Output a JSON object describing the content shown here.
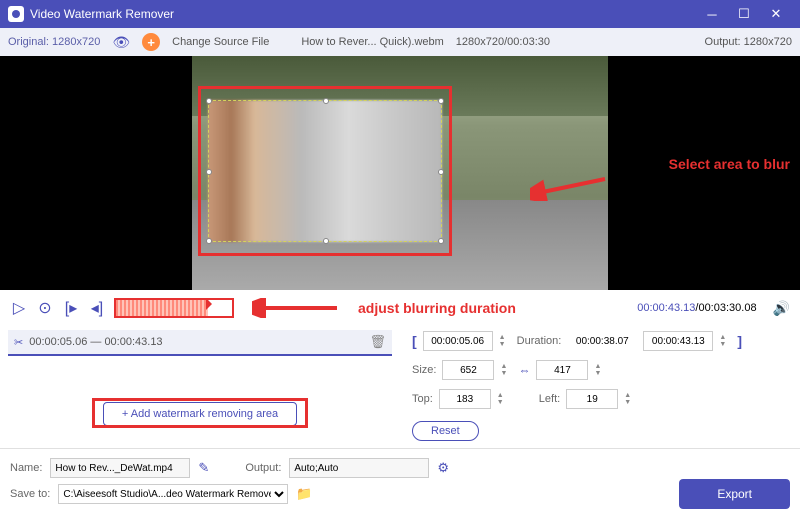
{
  "titlebar": {
    "title": "Video Watermark Remover"
  },
  "infobar": {
    "original": "Original: 1280x720",
    "change_src": "Change Source File",
    "filename": "How to Rever... Quick).webm",
    "dims": "1280x720/00:03:30",
    "output": "Output: 1280x720"
  },
  "annotations": {
    "select_area": "Select area to blur",
    "adjust_dur": "adjust blurring duration"
  },
  "controls": {
    "time_cur": "00:00:43.13",
    "time_total": "/00:03:30.08"
  },
  "region": {
    "range": "00:00:05.06 — 00:00:43.13"
  },
  "params": {
    "start": "00:00:05.06",
    "dur_label": "Duration:",
    "dur": "00:00:38.07",
    "end": "00:00:43.13",
    "size_label": "Size:",
    "size_w": "652",
    "size_h": "417",
    "top_label": "Top:",
    "top": "183",
    "left_label": "Left:",
    "left": "19",
    "reset": "Reset"
  },
  "add_btn": "Add watermark removing area",
  "bottom": {
    "name_label": "Name:",
    "name": "How to Rev..._DeWat.mp4",
    "output_label": "Output:",
    "output": "Auto;Auto",
    "saveto_label": "Save to:",
    "saveto": "C:\\Aiseesoft Studio\\A...deo Watermark Remover",
    "export": "Export"
  }
}
